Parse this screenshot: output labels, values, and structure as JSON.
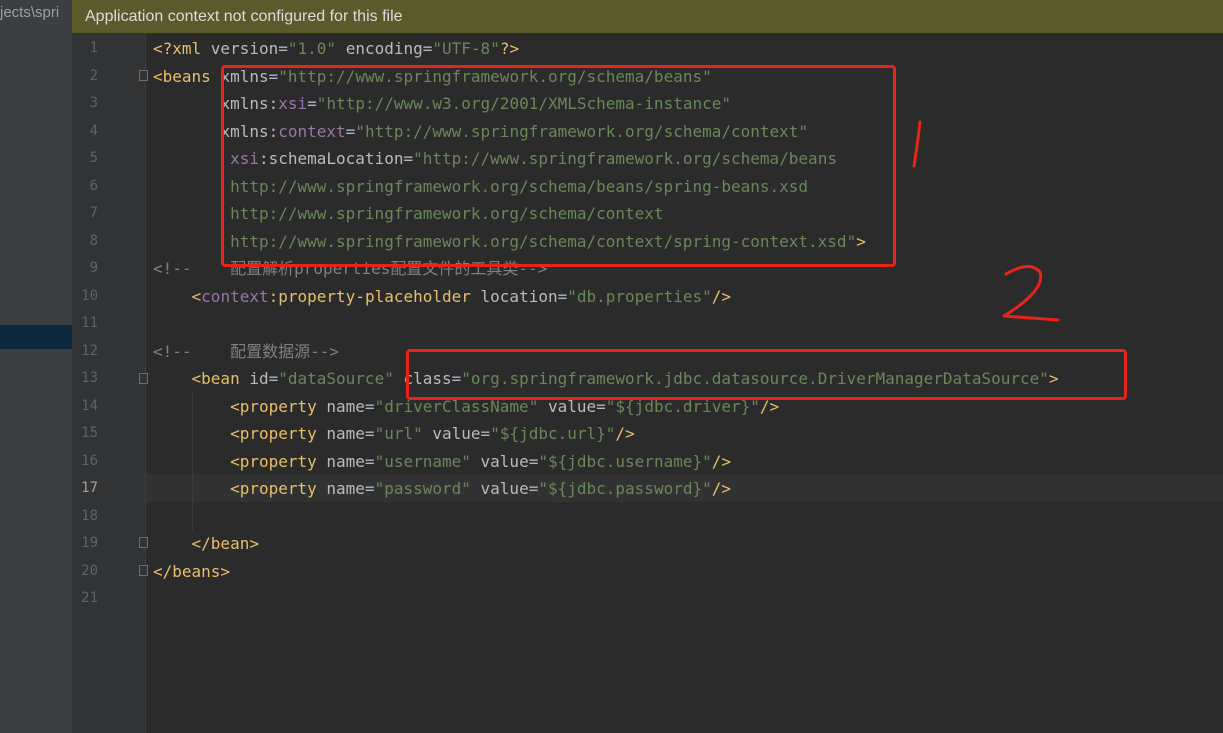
{
  "project_tree": {
    "path_fragment": "jects\\spri"
  },
  "notification": {
    "text": "Application context not configured for this file"
  },
  "editor": {
    "line_numbers": [
      "1",
      "2",
      "3",
      "4",
      "5",
      "6",
      "7",
      "8",
      "9",
      "10",
      "11",
      "12",
      "13",
      "14",
      "15",
      "16",
      "17",
      "18",
      "19",
      "20",
      "21"
    ],
    "current_line": "17",
    "lines": [
      [
        [
          "t",
          "<?xml "
        ],
        [
          "a",
          "version"
        ],
        [
          "p",
          "="
        ],
        [
          "v",
          "\"1.0\""
        ],
        [
          "p",
          " "
        ],
        [
          "a",
          "encoding"
        ],
        [
          "p",
          "="
        ],
        [
          "v",
          "\"UTF-8\""
        ],
        [
          "t",
          "?>"
        ]
      ],
      [
        [
          "t",
          "<beans "
        ],
        [
          "a",
          "xmlns"
        ],
        [
          "p",
          "="
        ],
        [
          "v",
          "\"http://www.springframework.org/schema/beans\""
        ]
      ],
      [
        [
          "p",
          "       "
        ],
        [
          "a",
          "xmlns:"
        ],
        [
          "ns",
          "xsi"
        ],
        [
          "p",
          "="
        ],
        [
          "v",
          "\"http://www.w3.org/2001/XMLSchema-instance\""
        ]
      ],
      [
        [
          "p",
          "       "
        ],
        [
          "a",
          "xmlns:"
        ],
        [
          "ns",
          "context"
        ],
        [
          "p",
          "="
        ],
        [
          "v",
          "\"http://www.springframework.org/schema/context\""
        ]
      ],
      [
        [
          "p",
          "        "
        ],
        [
          "ns",
          "xsi"
        ],
        [
          "a",
          ":schemaLocation"
        ],
        [
          "p",
          "="
        ],
        [
          "v",
          "\"http://www.springframework.org/schema/beans"
        ]
      ],
      [
        [
          "v",
          "        http://www.springframework.org/schema/beans/spring-beans.xsd"
        ]
      ],
      [
        [
          "v",
          "        http://www.springframework.org/schema/context"
        ]
      ],
      [
        [
          "v",
          "        http://www.springframework.org/schema/context/spring-context.xsd\""
        ],
        [
          "t",
          ">"
        ]
      ],
      [
        [
          "c",
          "<!--    配置解析properties配置文件的工具类-->"
        ]
      ],
      [
        [
          "p",
          "    "
        ],
        [
          "t",
          "<"
        ],
        [
          "ns",
          "context"
        ],
        [
          "t",
          ":property-placeholder "
        ],
        [
          "a",
          "location"
        ],
        [
          "p",
          "="
        ],
        [
          "v",
          "\"db.properties\""
        ],
        [
          "t",
          "/>"
        ]
      ],
      [],
      [
        [
          "c",
          "<!--    配置数据源-->"
        ]
      ],
      [
        [
          "p",
          "    "
        ],
        [
          "t",
          "<bean "
        ],
        [
          "a",
          "id"
        ],
        [
          "p",
          "="
        ],
        [
          "v",
          "\"dataSource\""
        ],
        [
          "p",
          " "
        ],
        [
          "a",
          "class"
        ],
        [
          "p",
          "="
        ],
        [
          "v",
          "\"org.springframework.jdbc.datasource.DriverManagerDataSource\""
        ],
        [
          "t",
          ">"
        ]
      ],
      [
        [
          "p",
          "        "
        ],
        [
          "t",
          "<property "
        ],
        [
          "a",
          "name"
        ],
        [
          "p",
          "="
        ],
        [
          "v",
          "\"driverClassName\""
        ],
        [
          "p",
          " "
        ],
        [
          "a",
          "value"
        ],
        [
          "p",
          "="
        ],
        [
          "v",
          "\"${jdbc.driver}\""
        ],
        [
          "t",
          "/>"
        ]
      ],
      [
        [
          "p",
          "        "
        ],
        [
          "t",
          "<property "
        ],
        [
          "a",
          "name"
        ],
        [
          "p",
          "="
        ],
        [
          "v",
          "\"url\""
        ],
        [
          "p",
          " "
        ],
        [
          "a",
          "value"
        ],
        [
          "p",
          "="
        ],
        [
          "v",
          "\"${jdbc.url}\""
        ],
        [
          "t",
          "/>"
        ]
      ],
      [
        [
          "p",
          "        "
        ],
        [
          "t",
          "<property "
        ],
        [
          "a",
          "name"
        ],
        [
          "p",
          "="
        ],
        [
          "v",
          "\"username\""
        ],
        [
          "p",
          " "
        ],
        [
          "a",
          "value"
        ],
        [
          "p",
          "="
        ],
        [
          "v",
          "\"${jdbc.username}\""
        ],
        [
          "t",
          "/>"
        ]
      ],
      [
        [
          "p",
          "        "
        ],
        [
          "t",
          "<property "
        ],
        [
          "a",
          "name"
        ],
        [
          "p",
          "="
        ],
        [
          "v",
          "\"password\""
        ],
        [
          "p",
          " "
        ],
        [
          "a",
          "value"
        ],
        [
          "p",
          "="
        ],
        [
          "v",
          "\"${jdbc.password}\""
        ],
        [
          "t",
          "/>"
        ]
      ],
      [],
      [
        [
          "p",
          "    "
        ],
        [
          "t",
          "</bean>"
        ]
      ],
      [
        [
          "t",
          "</beans>"
        ]
      ],
      []
    ]
  },
  "annotations": [
    {
      "label": "1"
    },
    {
      "label": "2"
    }
  ],
  "colors": {
    "annotation_red": "#e8231a",
    "tag": "#e8bf6a",
    "value": "#6a8759",
    "namespace": "#9876aa"
  }
}
